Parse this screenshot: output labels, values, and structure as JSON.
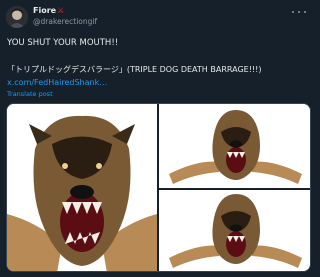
{
  "user": {
    "display_name": "Fiore",
    "name_emoji": "⚔",
    "handle": "@drakerectiongif"
  },
  "tweet": {
    "line1": "YOU SHUT YOUR MOUTH!!",
    "line2": "「トリプルドッグデスバラージ」(TRIPLE DOG DEATH BARRAGE!!!)",
    "link": "x.com/FedHairedShank…",
    "translate": "Translate post"
  },
  "media": {
    "images": [
      {
        "icon": "snarling-dog-image"
      },
      {
        "icon": "snarling-dog-image"
      },
      {
        "icon": "snarling-dog-image"
      }
    ]
  },
  "icons": {
    "more": "more-options-icon",
    "avatar": "avatar-image"
  },
  "colors": {
    "background": "#15202b",
    "text": "#e7e9ea",
    "secondary": "#8b98a5",
    "link": "#1d9bf0",
    "border": "#38444d"
  }
}
